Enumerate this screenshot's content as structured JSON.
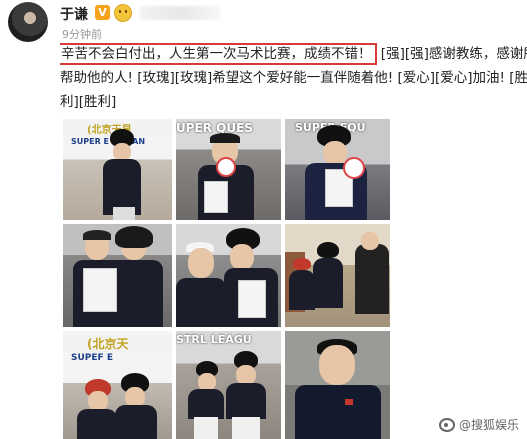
{
  "post": {
    "author": "于谦",
    "badge_vip": "V",
    "timestamp": "9分钟前",
    "highlighted_text": "辛苦不会白付出，人生第一次马术比赛，成绩不错！",
    "line1_rest": "[强][强]感谢教练，感谢所有",
    "line2": "帮助他的人! [玫瑰][玫瑰]希望这个爱好能一直伴随着他! [爱心][爱心]加油! [胜",
    "line3": "利][胜利]"
  },
  "photos": {
    "p1_banner": "(北京天星",
    "p1_banner2": "SUPER E  STRIAN",
    "p2_banner": "UPER  QUES",
    "p3_banner": "SUPER  EQU",
    "p7_banner": "(北京天",
    "p7_banner2": "SUPEF  E",
    "p8_banner": "STRL  LEAGU"
  },
  "watermark": {
    "text": "@搜狐娱乐"
  },
  "colors": {
    "highlight_border": "#d63a3a",
    "vip_badge": "#f7a21b"
  }
}
